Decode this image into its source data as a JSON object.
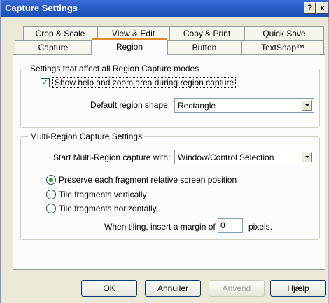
{
  "window": {
    "title": "Capture Settings",
    "help_btn": "?",
    "close_btn": "x"
  },
  "tabs_row1": [
    "Crop & Scale",
    "View & Edit",
    "Copy & Print",
    "Quick Save"
  ],
  "tabs_row2": [
    "Capture",
    "Region",
    "Button",
    "TextSnap™"
  ],
  "active_tab": "Region",
  "group1": {
    "title": "Settings that affect all Region Capture modes",
    "checkbox_label": "Show help and zoom area during region capture",
    "checkbox_checked": true,
    "shape_label": "Default region shape:",
    "shape_value": "Rectangle"
  },
  "group2": {
    "title": "Multi-Region Capture Settings",
    "start_label": "Start Multi-Region capture with:",
    "start_value": "Window/Control Selection",
    "radios": [
      {
        "label": "Preserve each fragment relative screen position",
        "selected": true
      },
      {
        "label": "Tile fragments vertically",
        "selected": false
      },
      {
        "label": "Tile fragments horizontally",
        "selected": false
      }
    ],
    "margin_label": "When tiling, insert a margin of",
    "margin_value": "0",
    "margin_unit": "pixels."
  },
  "buttons": {
    "ok": "OK",
    "cancel": "Annuller",
    "apply": "Anvend",
    "help": "Hjælp"
  }
}
